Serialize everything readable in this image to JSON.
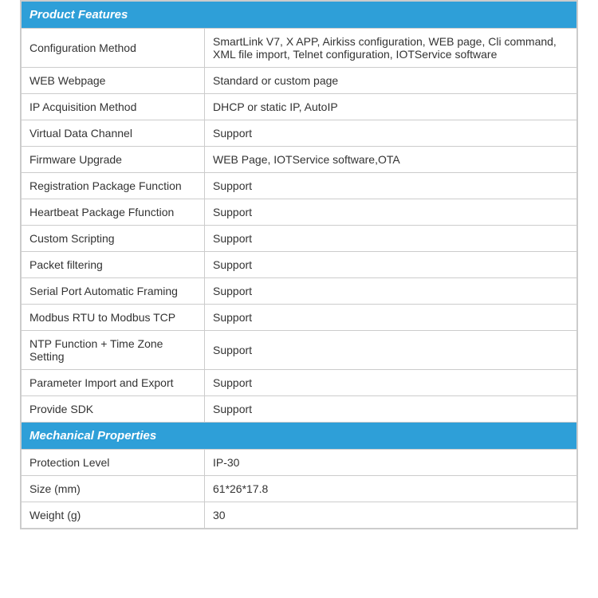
{
  "sections": [
    {
      "type": "header",
      "label": "Product Features"
    },
    {
      "type": "row",
      "label": "Configuration Method",
      "value": "SmartLink V7, X APP, Airkiss configuration, WEB page, Cli command, XML file import, Telnet configuration, IOTService software"
    },
    {
      "type": "row",
      "label": "WEB Webpage",
      "value": "Standard or custom page"
    },
    {
      "type": "row",
      "label": "IP Acquisition Method",
      "value": "DHCP or static IP, AutoIP"
    },
    {
      "type": "row",
      "label": "Virtual Data Channel",
      "value": "Support"
    },
    {
      "type": "row",
      "label": "Firmware Upgrade",
      "value": "WEB Page, IOTService software,OTA"
    },
    {
      "type": "row",
      "label": "Registration Package Function",
      "value": "Support"
    },
    {
      "type": "row",
      "label": "Heartbeat Package Ffunction",
      "value": "Support"
    },
    {
      "type": "row",
      "label": "Custom Scripting",
      "value": "Support"
    },
    {
      "type": "row",
      "label": "Packet filtering",
      "value": "Support"
    },
    {
      "type": "row",
      "label": "Serial Port Automatic Framing",
      "value": "Support"
    },
    {
      "type": "row",
      "label": "Modbus RTU to Modbus TCP",
      "value": "Support"
    },
    {
      "type": "row",
      "label": "NTP Function + Time Zone Setting",
      "value": "Support"
    },
    {
      "type": "row",
      "label": "Parameter Import and Export",
      "value": "Support"
    },
    {
      "type": "row",
      "label": "Provide SDK",
      "value": "Support"
    },
    {
      "type": "header",
      "label": "Mechanical Properties"
    },
    {
      "type": "row",
      "label": "Protection Level",
      "value": "IP-30"
    },
    {
      "type": "row",
      "label": "Size (mm)",
      "value": "61*26*17.8"
    },
    {
      "type": "row",
      "label": "Weight (g)",
      "value": "30"
    }
  ]
}
